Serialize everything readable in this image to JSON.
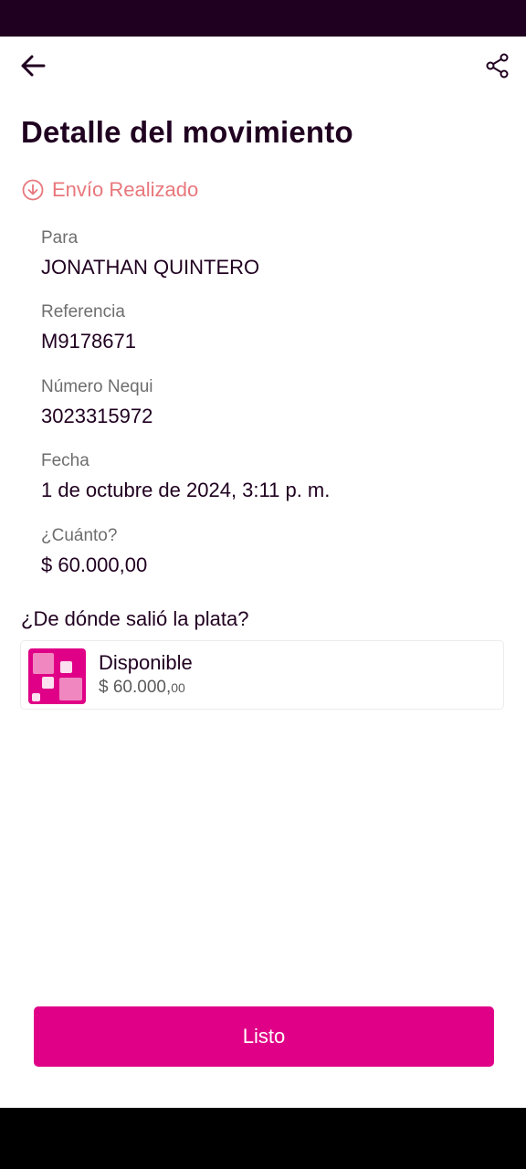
{
  "header": {
    "back_icon": "arrow-left-icon",
    "share_icon": "share-icon",
    "title": "Detalle del movimiento"
  },
  "status": {
    "icon": "arrow-down-circle-icon",
    "text": "Envío Realizado",
    "color": "#e8777c"
  },
  "details": [
    {
      "label": "Para",
      "value": "JONATHAN QUINTERO"
    },
    {
      "label": "Referencia",
      "value": "M9178671"
    },
    {
      "label": "Número Nequi",
      "value": "3023315972"
    },
    {
      "label": "Fecha",
      "value": "1 de octubre de 2024, 3:11 p. m."
    },
    {
      "label": "¿Cuánto?",
      "value": "$ 60.000,00"
    }
  ],
  "source": {
    "question": "¿De dónde salió la plata?",
    "pocket_icon": "pocket-squares-icon",
    "name": "Disponible",
    "amount_main": "$ 60.000,",
    "amount_cents": "00"
  },
  "actions": {
    "done_label": "Listo"
  },
  "colors": {
    "brand": "#e00087",
    "dark": "#200020",
    "status": "#e8777c"
  }
}
